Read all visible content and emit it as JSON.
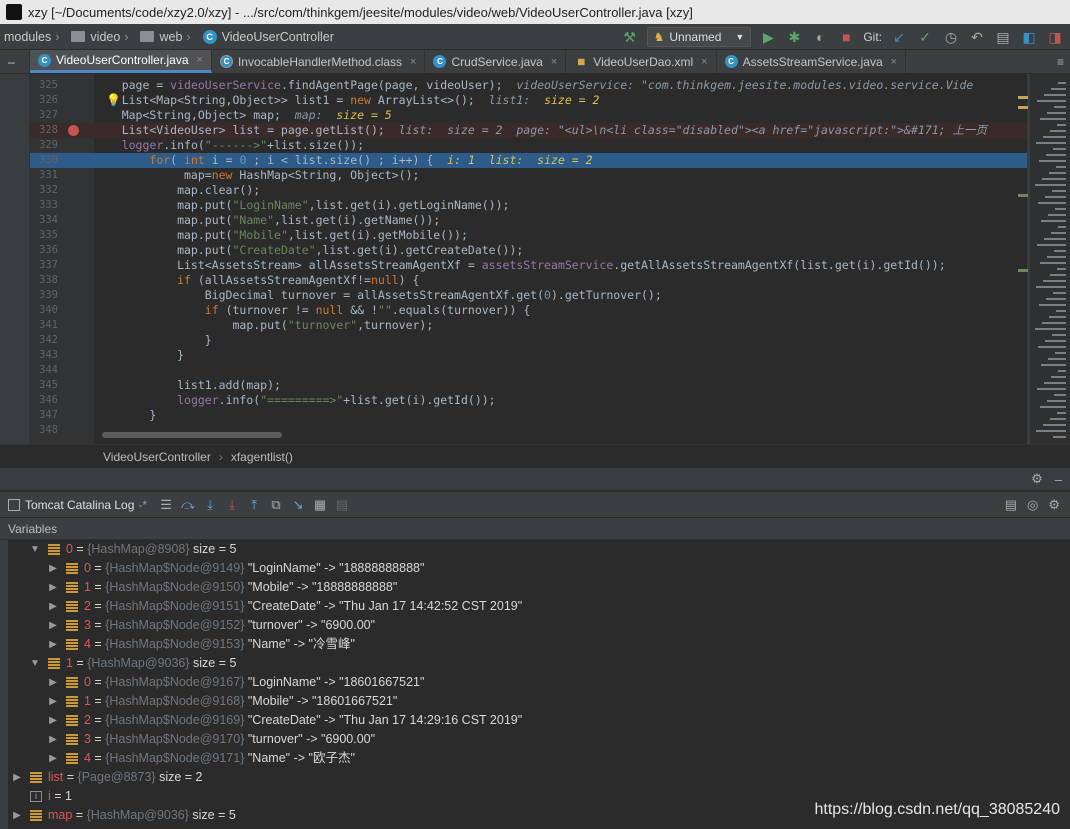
{
  "window": {
    "title": "xzy [~/Documents/code/xzy2.0/xzy] - .../src/com/thinkgem/jeesite/modules/video/web/VideoUserController.java [xzy]"
  },
  "navbar": {
    "crumbs": [
      "modules",
      "video",
      "web",
      "VideoUserController"
    ],
    "run_config": "Unnamed",
    "git_label": "Git:"
  },
  "tabs": [
    {
      "label": "VideoUserController.java",
      "kind": "c",
      "active": true
    },
    {
      "label": "InvocableHandlerMethod.class",
      "kind": "cls",
      "active": false
    },
    {
      "label": "CrudService.java",
      "kind": "c",
      "active": false
    },
    {
      "label": "VideoUserDao.xml",
      "kind": "xml",
      "active": false
    },
    {
      "label": "AssetsStreamService.java",
      "kind": "c",
      "active": false
    }
  ],
  "editor": {
    "lines": [
      {
        "n": "325",
        "html": "    page = <span class='f'>videoUserService</span>.findAgentPage(page, videoUser);  <span class='hint'>videoUserService: \"com.thinkgem.jeesite.modules.video.service.Vide</span>"
      },
      {
        "n": "326",
        "html": "    List&lt;Map&lt;String,Object&gt;&gt; list1 = <span class='k'>new</span> ArrayList&lt;&gt;();  <span class='hint'>list1:  <b>size = 2</b></span>"
      },
      {
        "n": "327",
        "html": "    Map&lt;String,Object&gt; map;  <span class='hint'>map:  <b>size = 5</b></span>"
      },
      {
        "n": "328",
        "html": "    List&lt;VideoUser&gt; list = page.getList();  <span class='hint'>list:  size = 2  page: \"&lt;ul&gt;\\n&lt;li class=\"disabled\"&gt;&lt;a href=\"javascript:\"&gt;&amp;#171; 上一页</span>"
      },
      {
        "n": "329",
        "html": "    <span class='f'>logger</span>.info(<span class='s'>\"------&gt;\"</span>+list.size());"
      },
      {
        "n": "330",
        "html": "        <span class='k'>for</span>( <span class='k'>int</span> i = <span class='n'>0</span> ; i &lt; list.size() ; i++) {  <span class='hint' style='color:#e0c050'>i: 1  list:  size = 2</span>"
      },
      {
        "n": "331",
        "html": "             map=<span class='k'>new</span> HashMap&lt;String, Object&gt;();"
      },
      {
        "n": "332",
        "html": "            map.clear();"
      },
      {
        "n": "333",
        "html": "            map.put(<span class='s'>\"LoginName\"</span>,list.get(i).getLoginName());"
      },
      {
        "n": "334",
        "html": "            map.put(<span class='s'>\"Name\"</span>,list.get(i).getName());"
      },
      {
        "n": "335",
        "html": "            map.put(<span class='s'>\"Mobile\"</span>,list.get(i).getMobile());"
      },
      {
        "n": "336",
        "html": "            map.put(<span class='s'>\"CreateDate\"</span>,list.get(i).getCreateDate());"
      },
      {
        "n": "337",
        "html": "            List&lt;AssetsStream&gt; allAssetsStreamAgentXf = <span class='f'>assetsStreamService</span>.getAllAssetsStreamAgentXf(list.get(i).getId());"
      },
      {
        "n": "338",
        "html": "            <span class='k'>if</span> (allAssetsStreamAgentXf!=<span class='k'>null</span>) {"
      },
      {
        "n": "339",
        "html": "                BigDecimal turnover = allAssetsStreamAgentXf.get(<span class='n'>0</span>).getTurnover();"
      },
      {
        "n": "340",
        "html": "                <span class='k'>if</span> (turnover != <span class='k'>null</span> &amp;&amp; !<span class='s'>\"\"</span>.equals(turnover)) {"
      },
      {
        "n": "341",
        "html": "                    map.put(<span class='s'>\"turnover\"</span>,turnover);"
      },
      {
        "n": "342",
        "html": "                }"
      },
      {
        "n": "343",
        "html": "            }"
      },
      {
        "n": "344",
        "html": ""
      },
      {
        "n": "345",
        "html": "            list1.add(map);"
      },
      {
        "n": "346",
        "html": "            <span class='f'>logger</span>.info(<span class='s'>\"=========&gt;\"</span>+list.get(i).getId());"
      },
      {
        "n": "347",
        "html": "        }"
      },
      {
        "n": "348",
        "html": ""
      }
    ]
  },
  "breadcrumb": {
    "class_name": "VideoUserController",
    "method": "xfagentlist()"
  },
  "debug": {
    "tab_label": "Tomcat Catalina Log",
    "tab_suffix": "-*"
  },
  "variables": {
    "header": "Variables",
    "rows": [
      {
        "depth": 0,
        "open": true,
        "icon": "map",
        "name": "0",
        "ref": "{HashMap@8908}",
        "value": "size = 5"
      },
      {
        "depth": 1,
        "open": false,
        "icon": "map",
        "name": "0",
        "ref": "{HashMap$Node@9149}",
        "value": "\"LoginName\" -> \"18888888888\""
      },
      {
        "depth": 1,
        "open": false,
        "icon": "map",
        "name": "1",
        "ref": "{HashMap$Node@9150}",
        "value": "\"Mobile\" -> \"18888888888\""
      },
      {
        "depth": 1,
        "open": false,
        "icon": "map",
        "name": "2",
        "ref": "{HashMap$Node@9151}",
        "value": "\"CreateDate\" -> \"Thu Jan 17 14:42:52 CST 2019\""
      },
      {
        "depth": 1,
        "open": false,
        "icon": "map",
        "name": "3",
        "ref": "{HashMap$Node@9152}",
        "value": "\"turnover\" -> \"6900.00\""
      },
      {
        "depth": 1,
        "open": false,
        "icon": "map",
        "name": "4",
        "ref": "{HashMap$Node@9153}",
        "value": "\"Name\" -> \"冷雪峰\""
      },
      {
        "depth": 0,
        "open": true,
        "icon": "map",
        "name": "1",
        "ref": "{HashMap@9036}",
        "value": "size = 5"
      },
      {
        "depth": 1,
        "open": false,
        "icon": "map",
        "name": "0",
        "ref": "{HashMap$Node@9167}",
        "value": "\"LoginName\" -> \"18601667521\""
      },
      {
        "depth": 1,
        "open": false,
        "icon": "map",
        "name": "1",
        "ref": "{HashMap$Node@9168}",
        "value": "\"Mobile\" -> \"18601667521\""
      },
      {
        "depth": 1,
        "open": false,
        "icon": "map",
        "name": "2",
        "ref": "{HashMap$Node@9169}",
        "value": "\"CreateDate\" -> \"Thu Jan 17 14:29:16 CST 2019\""
      },
      {
        "depth": 1,
        "open": false,
        "icon": "map",
        "name": "3",
        "ref": "{HashMap$Node@9170}",
        "value": "\"turnover\" -> \"6900.00\""
      },
      {
        "depth": 1,
        "open": false,
        "icon": "map",
        "name": "4",
        "ref": "{HashMap$Node@9171}",
        "value": "\"Name\" -> \"欧子杰\""
      },
      {
        "depth": -1,
        "open": false,
        "icon": "map",
        "name": "list",
        "ref": "{Page@8873}",
        "value": "size = 2"
      },
      {
        "depth": -1,
        "open": null,
        "icon": "prim",
        "name": "i",
        "ref": "",
        "value": "= 1"
      },
      {
        "depth": -1,
        "open": false,
        "icon": "map",
        "name": "map",
        "ref": "{HashMap@9036}",
        "value": "size = 5"
      }
    ]
  },
  "watermark": "https://blog.csdn.net/qq_38085240"
}
